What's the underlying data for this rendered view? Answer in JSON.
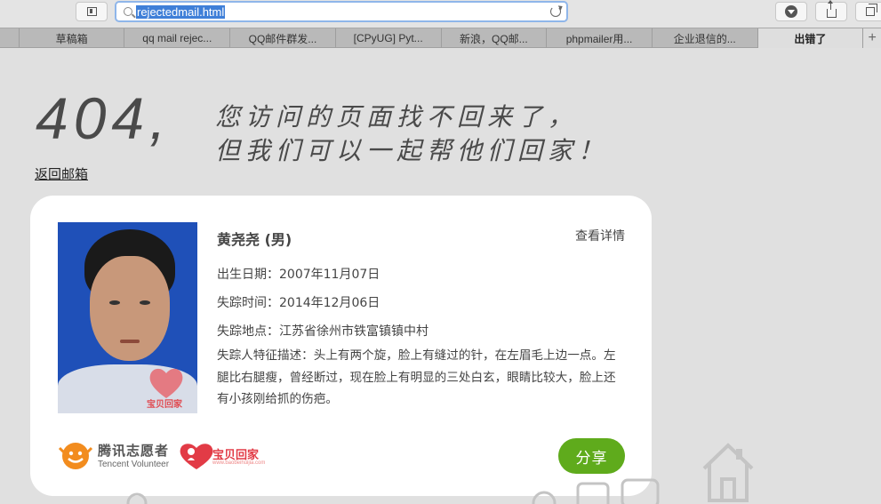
{
  "browser": {
    "address": "rejectedmail.html",
    "tabs": [
      "草稿箱",
      "qq mail rejec...",
      "QQ邮件群发...",
      "[CPyUG] Pyt...",
      "新浪，QQ邮...",
      "phpmailer用...",
      "企业退信的...",
      "出错了"
    ],
    "active_tab": 7,
    "icons": [
      "sidebar-icon",
      "search-icon",
      "reload-icon",
      "download-icon",
      "share-icon",
      "tabs-icon"
    ]
  },
  "page": {
    "code": "404",
    "comma": ",",
    "headline_line1": "您访问的页面找不回来了，",
    "headline_line2": "但我们可以一起帮他们回家！",
    "back_link": "返回邮箱"
  },
  "card": {
    "name": "黄尧尧 (男)",
    "details_link": "查看详情",
    "birth": "出生日期：2007年11月07日",
    "missing_time": "失踪时间：2014年12月06日",
    "missing_place": "失踪地点：江苏省徐州市铁富镇镇中村",
    "description": "失踪人特征描述：头上有两个旋，脸上有缝过的针，在左眉毛上边一点。左腿比右腿瘦，曾经断过，现在脸上有明显的三处白玄，眼睛比较大，脸上还有小孩刚给抓的伤疤。",
    "tencent_cn": "腾讯志愿者",
    "tencent_en": "Tencent Volunteer",
    "baobei_text": "宝贝回家",
    "baobei_url": "www.baobeihuijia.com",
    "photo_watermark": "宝贝回家",
    "share_button": "分享"
  },
  "colors": {
    "background": "#e0e0e0",
    "card": "#ffffff",
    "share_green": "#5fab1c",
    "baobei_red": "#e23b46",
    "tencent_orange": "#f28c1e"
  }
}
